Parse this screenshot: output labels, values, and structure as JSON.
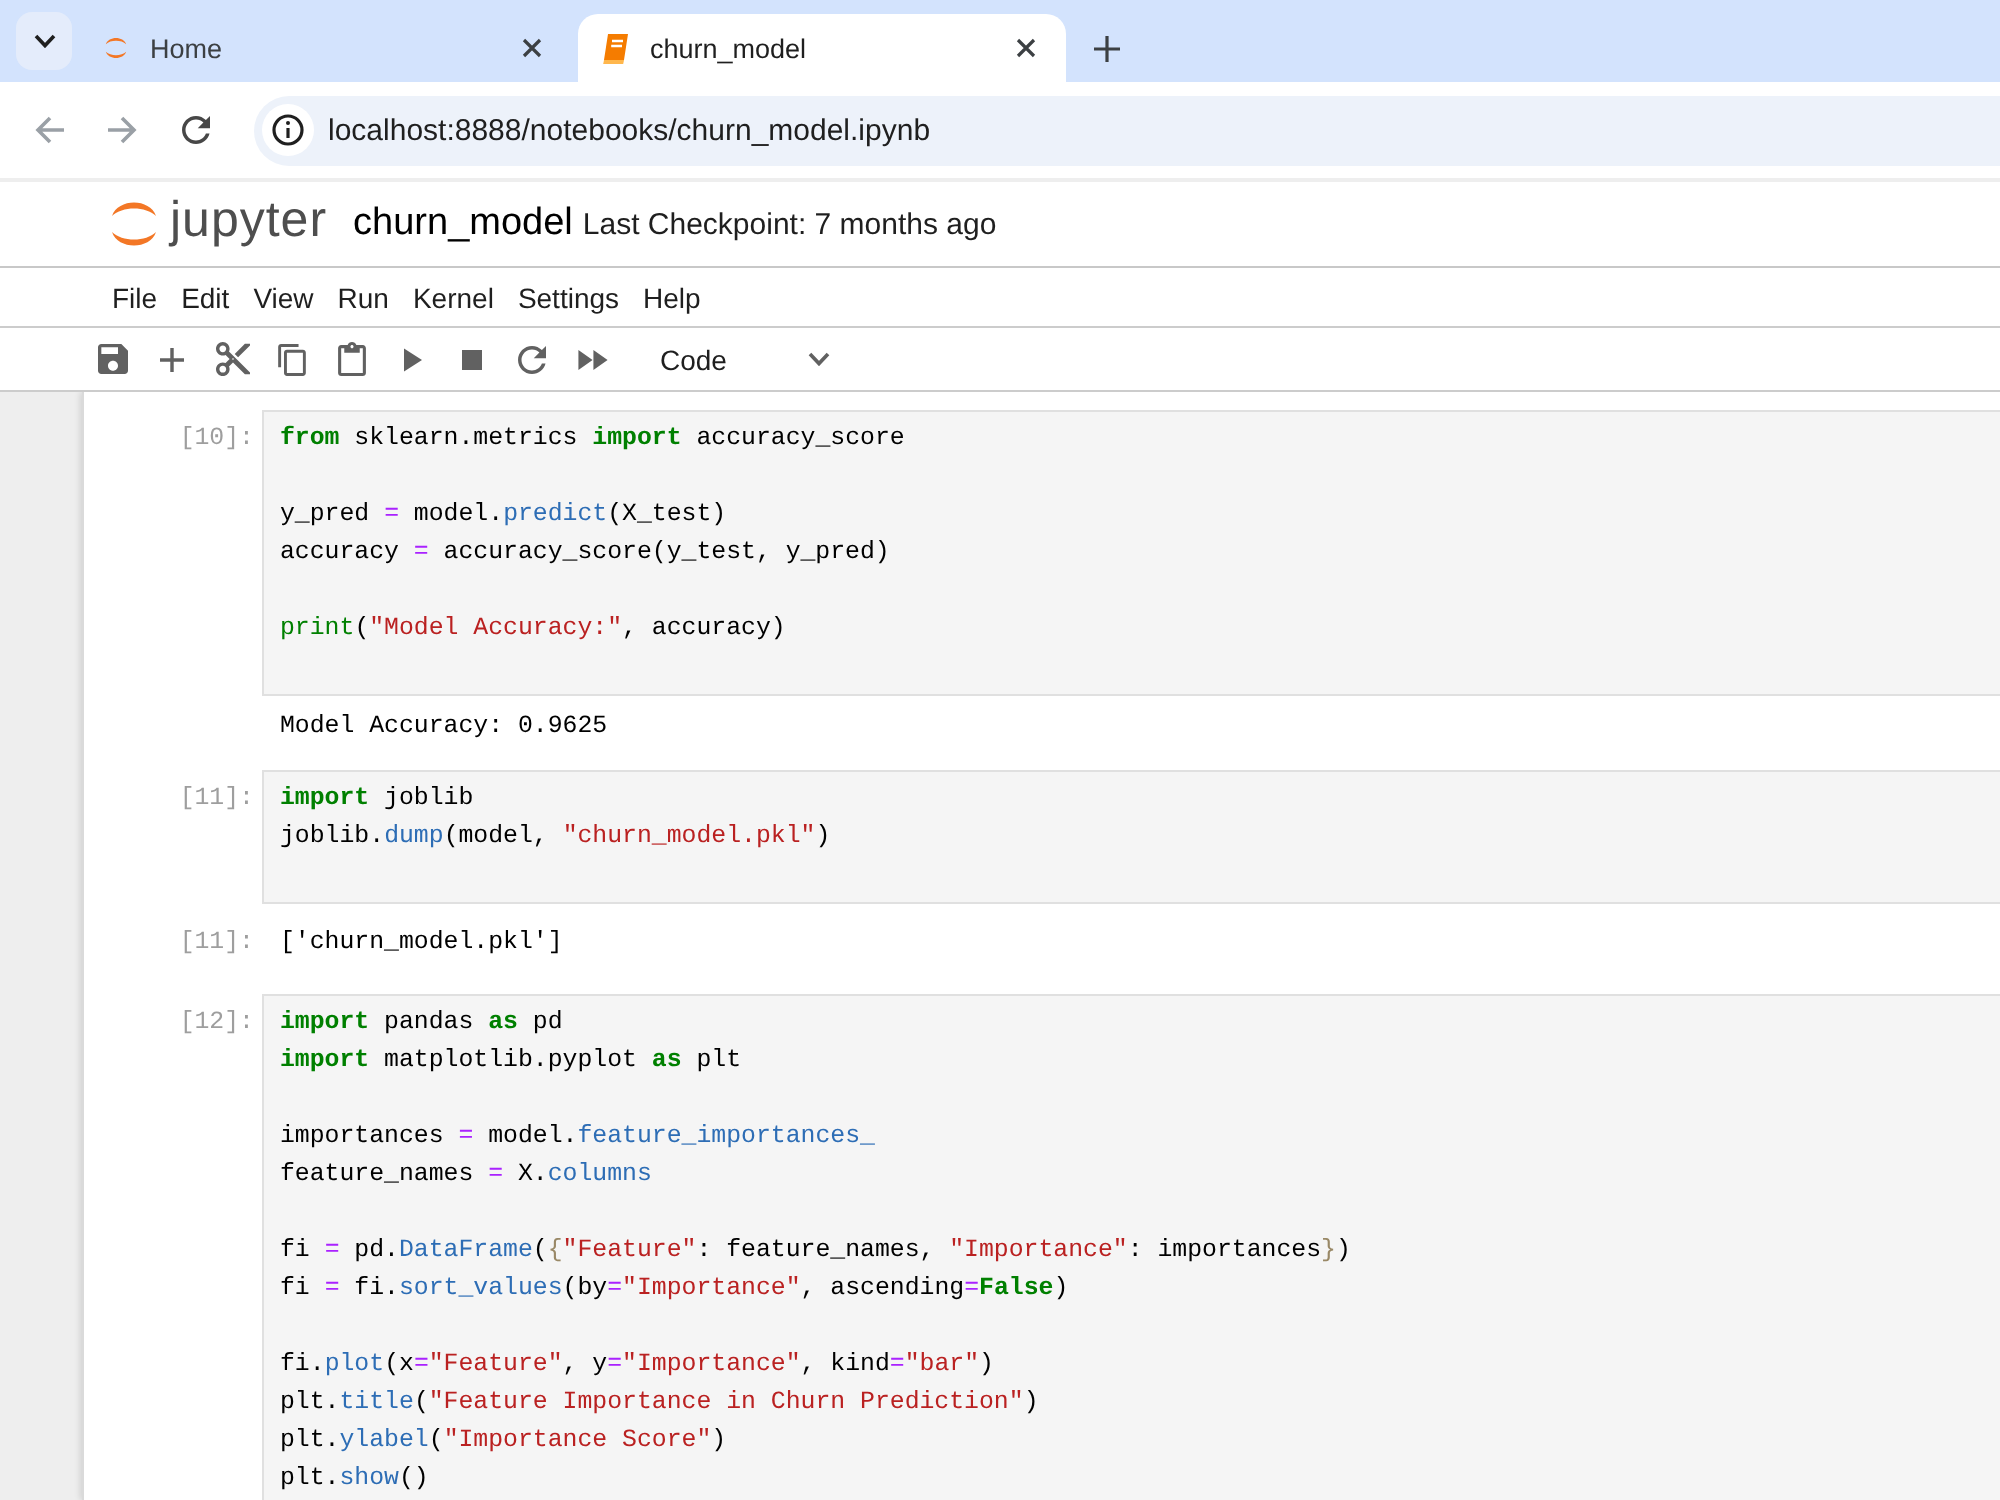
{
  "browser": {
    "tabs": [
      {
        "title": "Home",
        "selected": false
      },
      {
        "title": "churn_model",
        "selected": true
      }
    ],
    "url": "localhost:8888/notebooks/churn_model.ipynb"
  },
  "header": {
    "logo_text": "jupyter",
    "notebook_name": "churn_model",
    "checkpoint": "Last Checkpoint: 7 months ago"
  },
  "menu": [
    "File",
    "Edit",
    "View",
    "Run",
    "Kernel",
    "Settings",
    "Help"
  ],
  "toolbar": {
    "cell_type": "Code"
  },
  "cells": [
    {
      "prompt": "[10]:",
      "blocks": [
        [
          [
            {
              "kind": "keyword",
              "text": "from"
            },
            {
              "kind": "plain",
              "text": " sklearn.metrics "
            },
            {
              "kind": "keyword",
              "text": "import"
            },
            {
              "kind": "plain",
              "text": " accuracy_score"
            }
          ]
        ],
        [
          [
            {
              "kind": "plain",
              "text": "y_pred "
            },
            {
              "kind": "operator",
              "text": "="
            },
            {
              "kind": "plain",
              "text": " model."
            },
            {
              "kind": "property",
              "text": "predict"
            },
            {
              "kind": "plain",
              "text": "(X_test)"
            }
          ],
          [
            {
              "kind": "plain",
              "text": "accuracy "
            },
            {
              "kind": "operator",
              "text": "="
            },
            {
              "kind": "plain",
              "text": " accuracy_score(y_test, y_pred)"
            }
          ]
        ],
        [
          [
            {
              "kind": "builtin",
              "text": "print"
            },
            {
              "kind": "plain",
              "text": "("
            },
            {
              "kind": "string",
              "text": "\"Model Accuracy:\""
            },
            {
              "kind": "plain",
              "text": ", accuracy)"
            }
          ]
        ]
      ],
      "output": {
        "text": "Model Accuracy: 0.9625"
      }
    },
    {
      "prompt": "[11]:",
      "blocks": [
        [
          [
            {
              "kind": "keyword",
              "text": "import"
            },
            {
              "kind": "plain",
              "text": " joblib"
            }
          ],
          [
            {
              "kind": "plain",
              "text": "joblib."
            },
            {
              "kind": "property",
              "text": "dump"
            },
            {
              "kind": "plain",
              "text": "(model, "
            },
            {
              "kind": "string",
              "text": "\"churn_model.pkl\""
            },
            {
              "kind": "plain",
              "text": ")"
            }
          ]
        ]
      ],
      "output": {
        "prompt": "[11]:",
        "text": "['churn_model.pkl']"
      }
    },
    {
      "prompt": "[12]:",
      "blocks": [
        [
          [
            {
              "kind": "keyword",
              "text": "import"
            },
            {
              "kind": "plain",
              "text": " pandas "
            },
            {
              "kind": "keyword",
              "text": "as"
            },
            {
              "kind": "plain",
              "text": " pd"
            }
          ],
          [
            {
              "kind": "keyword",
              "text": "import"
            },
            {
              "kind": "plain",
              "text": " matplotlib.pyplot "
            },
            {
              "kind": "keyword",
              "text": "as"
            },
            {
              "kind": "plain",
              "text": " plt"
            }
          ]
        ],
        [
          [
            {
              "kind": "plain",
              "text": "importances "
            },
            {
              "kind": "operator",
              "text": "="
            },
            {
              "kind": "plain",
              "text": " model."
            },
            {
              "kind": "property",
              "text": "feature_importances_"
            }
          ],
          [
            {
              "kind": "plain",
              "text": "feature_names "
            },
            {
              "kind": "operator",
              "text": "="
            },
            {
              "kind": "plain",
              "text": " X."
            },
            {
              "kind": "property",
              "text": "columns"
            }
          ]
        ],
        [
          [
            {
              "kind": "plain",
              "text": "fi "
            },
            {
              "kind": "operator",
              "text": "="
            },
            {
              "kind": "plain",
              "text": " pd."
            },
            {
              "kind": "property",
              "text": "DataFrame"
            },
            {
              "kind": "plain",
              "text": "("
            },
            {
              "kind": "bracket",
              "text": "{"
            },
            {
              "kind": "string",
              "text": "\"Feature\""
            },
            {
              "kind": "plain",
              "text": ": feature_names, "
            },
            {
              "kind": "string",
              "text": "\"Importance\""
            },
            {
              "kind": "plain",
              "text": ": importances"
            },
            {
              "kind": "bracket",
              "text": "}"
            },
            {
              "kind": "plain",
              "text": ")"
            }
          ],
          [
            {
              "kind": "plain",
              "text": "fi "
            },
            {
              "kind": "operator",
              "text": "="
            },
            {
              "kind": "plain",
              "text": " fi."
            },
            {
              "kind": "property",
              "text": "sort_values"
            },
            {
              "kind": "plain",
              "text": "(by"
            },
            {
              "kind": "operator",
              "text": "="
            },
            {
              "kind": "string",
              "text": "\"Importance\""
            },
            {
              "kind": "plain",
              "text": ", ascending"
            },
            {
              "kind": "operator",
              "text": "="
            },
            {
              "kind": "keyword",
              "text": "False"
            },
            {
              "kind": "plain",
              "text": ")"
            }
          ]
        ],
        [
          [
            {
              "kind": "plain",
              "text": "fi."
            },
            {
              "kind": "property",
              "text": "plot"
            },
            {
              "kind": "plain",
              "text": "(x"
            },
            {
              "kind": "operator",
              "text": "="
            },
            {
              "kind": "string",
              "text": "\"Feature\""
            },
            {
              "kind": "plain",
              "text": ", y"
            },
            {
              "kind": "operator",
              "text": "="
            },
            {
              "kind": "string",
              "text": "\"Importance\""
            },
            {
              "kind": "plain",
              "text": ", kind"
            },
            {
              "kind": "operator",
              "text": "="
            },
            {
              "kind": "string",
              "text": "\"bar\""
            },
            {
              "kind": "plain",
              "text": ")"
            }
          ],
          [
            {
              "kind": "plain",
              "text": "plt."
            },
            {
              "kind": "property",
              "text": "title"
            },
            {
              "kind": "plain",
              "text": "("
            },
            {
              "kind": "string",
              "text": "\"Feature Importance in Churn Prediction\""
            },
            {
              "kind": "plain",
              "text": ")"
            }
          ],
          [
            {
              "kind": "plain",
              "text": "plt."
            },
            {
              "kind": "property",
              "text": "ylabel"
            },
            {
              "kind": "plain",
              "text": "("
            },
            {
              "kind": "string",
              "text": "\"Importance Score\""
            },
            {
              "kind": "plain",
              "text": ")"
            }
          ],
          [
            {
              "kind": "plain",
              "text": "plt."
            },
            {
              "kind": "property",
              "text": "show"
            },
            {
              "kind": "plain",
              "text": "()"
            }
          ]
        ]
      ]
    }
  ]
}
